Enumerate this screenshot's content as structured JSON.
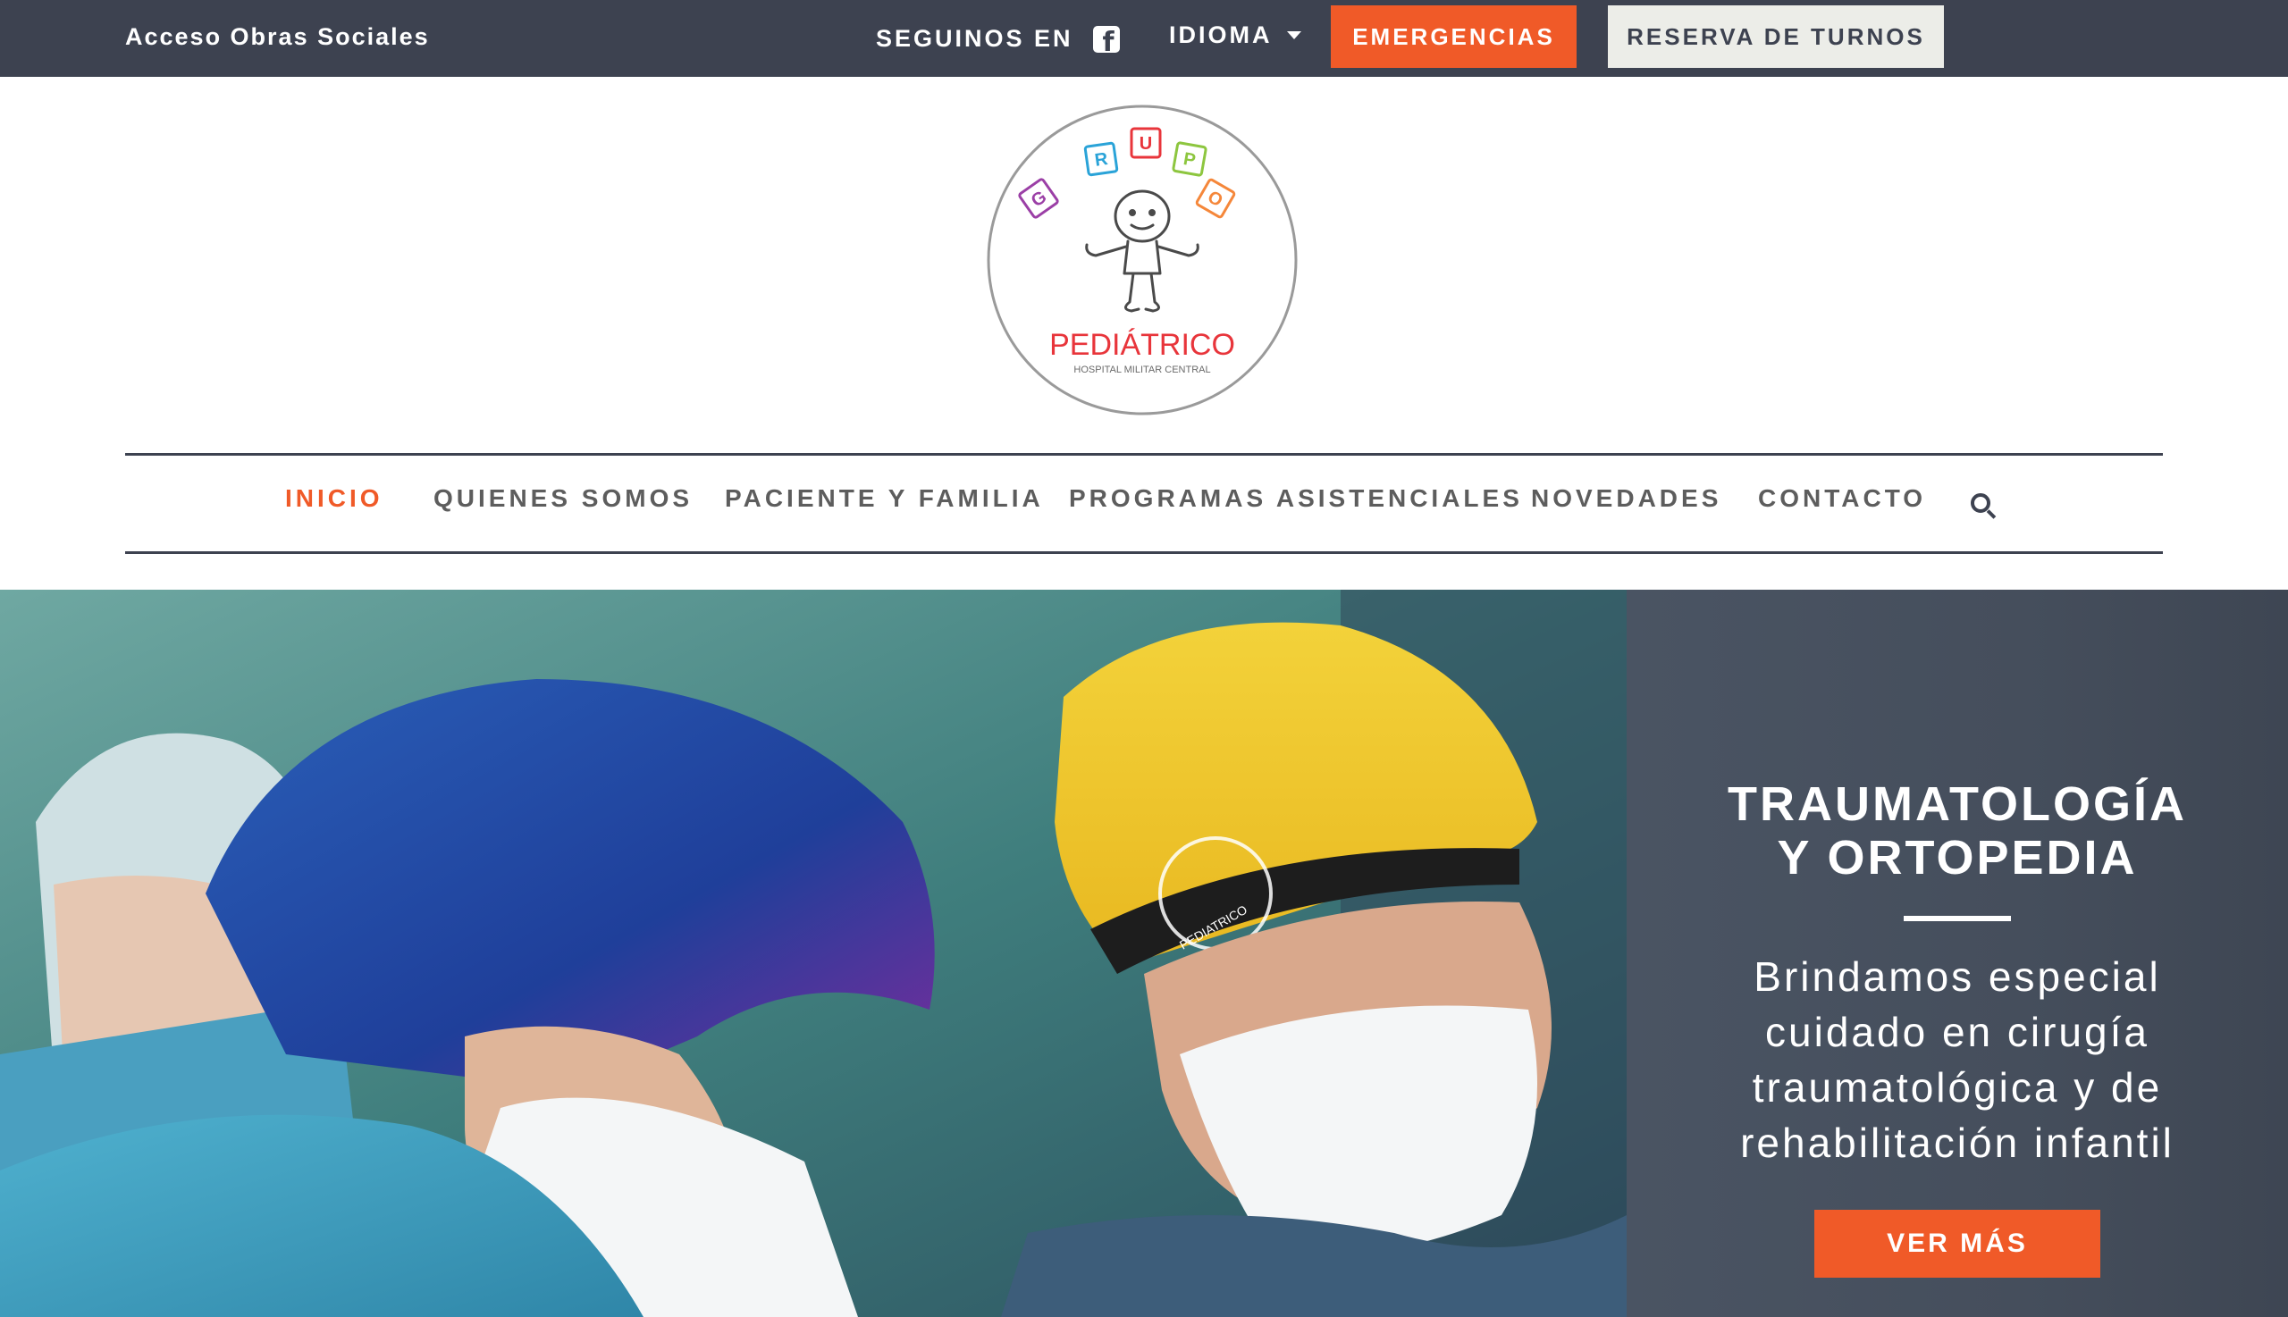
{
  "topbar": {
    "obras_link": "Acceso Obras Sociales",
    "seguinos_label": "SEGUINOS EN",
    "idioma_label": "IDIOMA",
    "emergencias_label": "EMERGENCIAS",
    "reserva_label": "RESERVA DE TURNOS"
  },
  "logo": {
    "letters": [
      "G",
      "R",
      "U",
      "P",
      "O"
    ],
    "name": "PEDIÁTRICO",
    "tagline": "HOSPITAL MILITAR CENTRAL"
  },
  "nav": {
    "items": [
      {
        "label": "INICIO",
        "active": true
      },
      {
        "label": "QUIENES SOMOS",
        "active": false
      },
      {
        "label": "PACIENTE Y FAMILIA",
        "active": false
      },
      {
        "label": "PROGRAMAS ASISTENCIALES",
        "active": false
      },
      {
        "label": "NOVEDADES",
        "active": false
      },
      {
        "label": "CONTACTO",
        "active": false
      }
    ],
    "search_icon": "search-icon"
  },
  "hero": {
    "title_line1": "TRAUMATOLOGÍA",
    "title_line2": "Y ORTOPEDIA",
    "subtitle_lines": [
      "Brindamos especial",
      "cuidado en cirugía",
      "traumatológica y de",
      "rehabilitación infantil"
    ],
    "button_label": "VER MÁS",
    "cap_logo_text": "PEDIATRICO"
  },
  "colors": {
    "topbar_bg": "#3d4250",
    "accent": "#f05a28",
    "reserva_bg": "#ecede8",
    "nav_text": "#5d5d5d",
    "panel_bg": "#4a5463"
  }
}
